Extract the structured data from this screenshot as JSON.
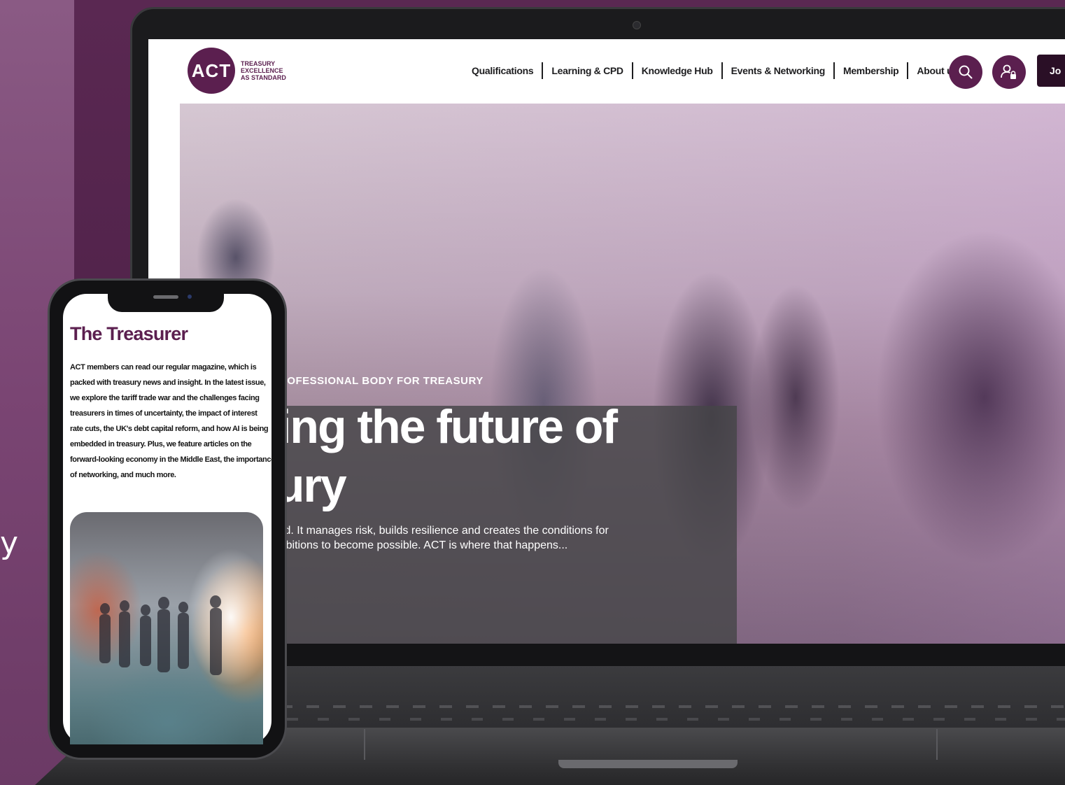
{
  "background": {
    "side_glyph": "y"
  },
  "site": {
    "logo": {
      "mark": "ACT",
      "tagline": [
        "TREASURY",
        "EXCELLENCE",
        "AS STANDARD"
      ]
    },
    "nav": [
      {
        "label": "Qualifications"
      },
      {
        "label": "Learning & CPD"
      },
      {
        "label": "Knowledge Hub"
      },
      {
        "label": "Events & Networking"
      },
      {
        "label": "Membership"
      },
      {
        "label": "About us"
      }
    ],
    "header_buttons": {
      "search_icon": "search-icon",
      "account_icon": "user-lock-icon",
      "join_label": "Jo"
    },
    "hero": {
      "eyebrow": "ED PROFESSIONAL BODY FOR TREASURY",
      "title_lines": [
        "ping the future of",
        "sury"
      ],
      "body_lines": [
        "forward. It manages risk, builds resilience and creates the conditions for",
        "n's ambitions to become possible. ACT is where that happens..."
      ]
    }
  },
  "phone": {
    "title": "The Treasurer",
    "body_lines": [
      "ACT members can read our regular magazine, which is",
      "packed with treasury news and insight. In the latest issue,",
      "we explore the tariff trade war and the challenges facing",
      "treasurers in times of uncertainty, the impact of interest",
      "rate cuts, the UK's debt capital reform, and how AI is being",
      "embedded in treasury. Plus, we feature articles on the",
      "forward-looking economy in the Middle East, the importance",
      "of networking, and much more."
    ]
  },
  "colors": {
    "brand": "#5b1f4f",
    "background": "#4e2148"
  }
}
